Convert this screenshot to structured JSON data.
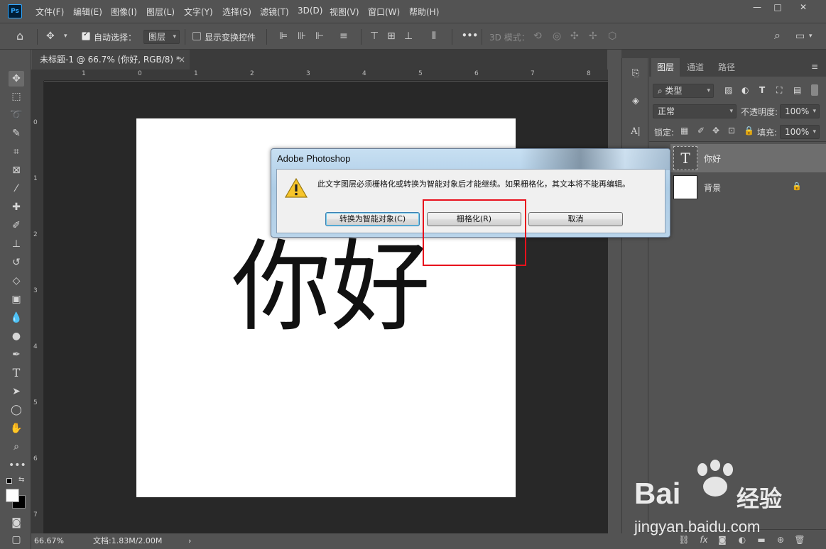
{
  "app": {
    "logo": "Ps"
  },
  "menu": [
    "文件(F)",
    "编辑(E)",
    "图像(I)",
    "图层(L)",
    "文字(Y)",
    "选择(S)",
    "滤镜(T)",
    "3D(D)",
    "视图(V)",
    "窗口(W)",
    "帮助(H)"
  ],
  "window_controls": {
    "minimize": "—",
    "maximize": "□",
    "close": "✕"
  },
  "options": {
    "auto_select_label": "自动选择：",
    "auto_select_checked": true,
    "auto_select_target": "图层",
    "show_transform_label": "显示变换控件",
    "show_transform_checked": false,
    "more": "•••",
    "mode_3d_label": "3D 模式："
  },
  "document": {
    "tab_title": "未标题-1 @ 66.7% (你好, RGB/8) *",
    "close": "×",
    "canvas_text": "你好",
    "ruler_h": [
      "1",
      "0",
      "1",
      "2",
      "3",
      "4",
      "5",
      "6",
      "7",
      "8"
    ],
    "ruler_v": [
      "0",
      "1",
      "2",
      "3",
      "4",
      "5",
      "6",
      "7"
    ]
  },
  "status": {
    "zoom": "66.67%",
    "doc_info": "文档:1.83M/2.00M",
    "arrow": "›"
  },
  "layers_panel": {
    "tabs": [
      "图层",
      "通道",
      "路径"
    ],
    "filter_kind": "类型",
    "blend_mode": "正常",
    "opacity_label": "不透明度:",
    "opacity_value": "100%",
    "lock_label": "锁定:",
    "fill_label": "填充:",
    "fill_value": "100%",
    "layers": [
      {
        "name": "你好",
        "type": "text",
        "thumb": "T",
        "selected": true
      },
      {
        "name": "背景",
        "type": "background",
        "locked": true,
        "selected": false
      }
    ]
  },
  "dialog": {
    "title": "Adobe Photoshop",
    "message": "此文字图层必须栅格化或转换为智能对象后才能继续。如果栅格化，其文本将不能再编辑。",
    "buttons": {
      "convert": "转换为智能对象(C)",
      "rasterize": "栅格化(R)",
      "cancel": "取消"
    }
  },
  "watermark": {
    "brand_left": "Bai",
    "brand_right": "经验",
    "url": "jingyan.baidu.com"
  },
  "colors": {
    "highlight": "#e8111c",
    "ui_bg": "#535353",
    "pasteboard": "#282828"
  }
}
